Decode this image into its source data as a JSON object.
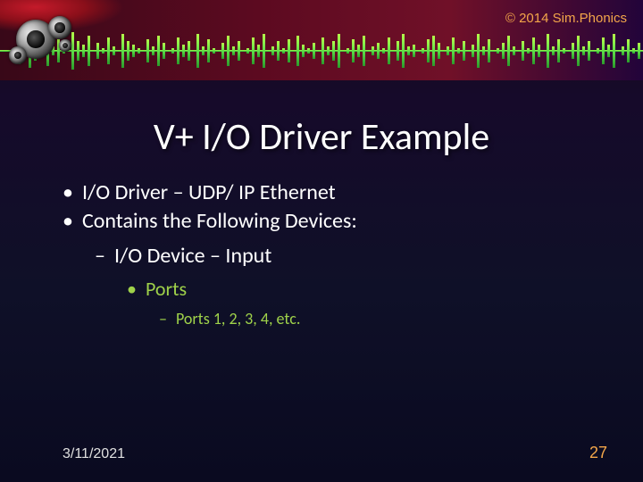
{
  "header": {
    "copyright": "© 2014 Sim.Phonics"
  },
  "title": "V+ I/O Driver Example",
  "bullets": {
    "l1a": "I/O Driver – UDP/ IP Ethernet",
    "l1b": "Contains the Following Devices:",
    "l2a": "I/O Device – Input",
    "l3a": "Ports",
    "l4a": "Ports 1, 2, 3, 4, etc."
  },
  "footer": {
    "date": "3/11/2021",
    "page": "27"
  }
}
